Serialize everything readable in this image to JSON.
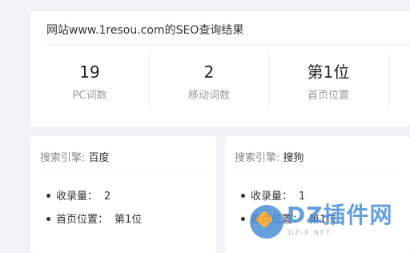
{
  "summary": {
    "title": "网站www.1resou.com的SEO查询结果",
    "stats": [
      {
        "value": "19",
        "label": "PC词数"
      },
      {
        "value": "2",
        "label": "移动词数"
      },
      {
        "value": "第1位",
        "label": "首页位置"
      }
    ]
  },
  "engines": [
    {
      "key_label": "搜索引擎:",
      "name": "百度",
      "items": [
        {
          "label": "收录量：",
          "value": "2"
        },
        {
          "label": "首页位置：",
          "value": "第1位"
        }
      ]
    },
    {
      "key_label": "搜索引擎:",
      "name": "搜狗",
      "items": [
        {
          "label": "收录量：",
          "value": "1"
        },
        {
          "label": "首页位置：",
          "value": "第1位"
        }
      ]
    }
  ],
  "watermark": {
    "text": "DZ插件网",
    "subtext": "DZ-X.NET",
    "colors": {
      "primary": "#4a90d9",
      "accent": "#f6a623"
    }
  }
}
